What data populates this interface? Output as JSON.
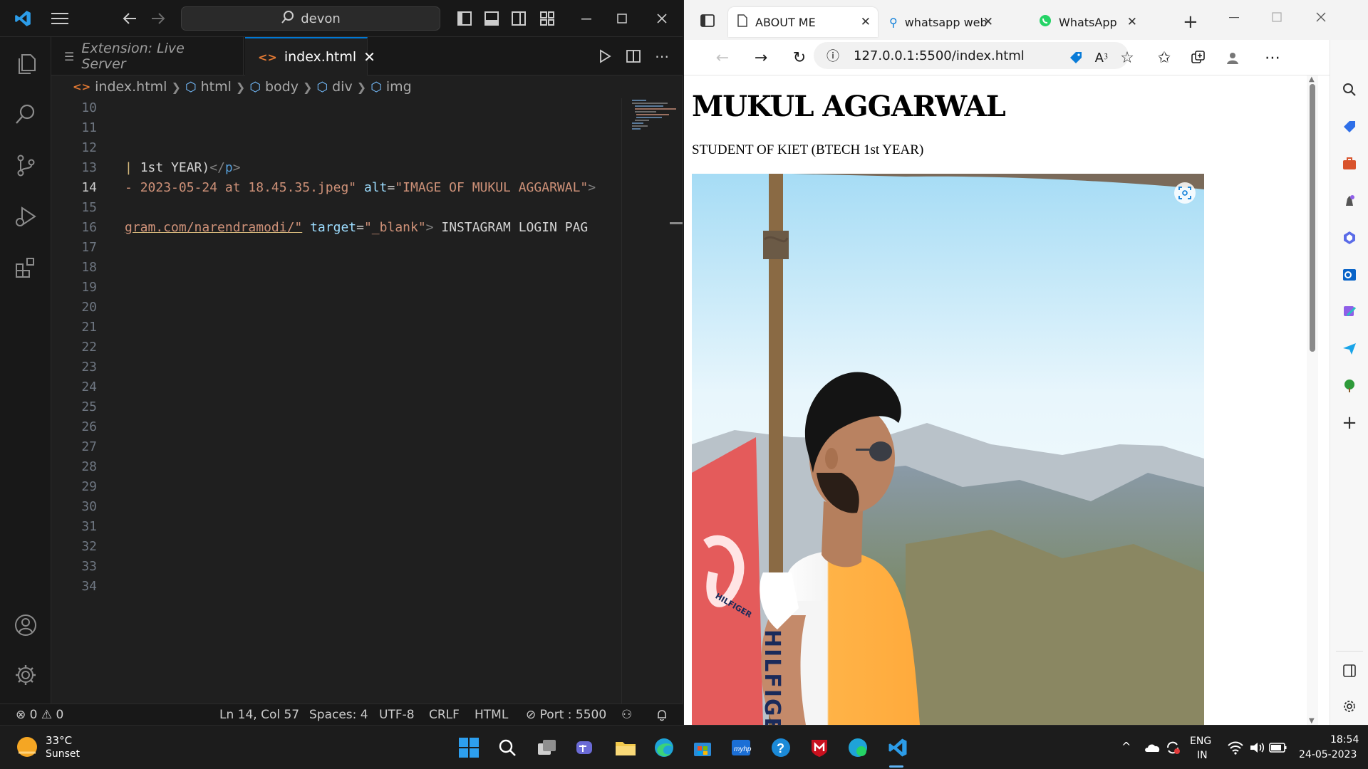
{
  "vscode": {
    "command_center": "devon",
    "tabs": [
      {
        "label": "Extension: Live Server",
        "icon": "preview-icon"
      },
      {
        "label": "index.html",
        "icon": "html-file-icon"
      }
    ],
    "breadcrumb": [
      "index.html",
      "html",
      "body",
      "div",
      "img"
    ],
    "line_numbers": [
      "10",
      "11",
      "12",
      "13",
      "14",
      "15",
      "16",
      "17",
      "18",
      "19",
      "20",
      "21",
      "22",
      "23",
      "24",
      "25",
      "26",
      "27",
      "28",
      "29",
      "30",
      "31",
      "32",
      "33",
      "34"
    ],
    "current_line": "14",
    "code": {
      "line13_text": "1st YEAR)",
      "line13_close_open": "</",
      "line13_close_tag": "p",
      "line13_close_end": ">",
      "line14_src": "2023-05-24 at 18.45.35.jpeg\"",
      "line14_attr": "alt",
      "line14_eq": "=",
      "line14_alt": "\"IMAGE OF MUKUL AGGARWAL\"",
      "line14_end": ">",
      "line16_href": "gram.com/narendramodi/\"",
      "line16_attr": "target",
      "line16_eq": "=",
      "line16_target": "\"_blank\"",
      "line16_gt": ">",
      "line16_text": " INSTAGRAM LOGIN PAG"
    },
    "status": {
      "errors": "0",
      "warnings": "0",
      "position": "Ln 14, Col 57",
      "spaces": "Spaces: 4",
      "encoding": "UTF-8",
      "eol": "CRLF",
      "language": "HTML",
      "port": "Port : 5500"
    }
  },
  "edge": {
    "tabs": [
      {
        "label": "ABOUT ME",
        "active": true
      },
      {
        "label": "whatsapp web - Sea"
      },
      {
        "label": "WhatsApp"
      }
    ],
    "url": "127.0.0.1:5500/index.html",
    "page": {
      "heading": "MUKUL AGGARWAL",
      "subtitle": "STUDENT OF KIET (BTECH 1st YEAR)",
      "photo_alt": "IMAGE OF MUKUL AGGARWAL",
      "shirt_text": "HILFIGE",
      "sleeve_text": "HILFIGER"
    }
  },
  "taskbar": {
    "weather_temp": "33°C",
    "weather_desc": "Sunset",
    "lang_top": "ENG",
    "lang_bottom": "IN",
    "time": "18:54",
    "date": "24-05-2023"
  },
  "colors": {
    "vscode_accent": "#0078d4",
    "edge_blue": "#0a7cd8",
    "taskbar_bg": "#1c1c1c"
  }
}
